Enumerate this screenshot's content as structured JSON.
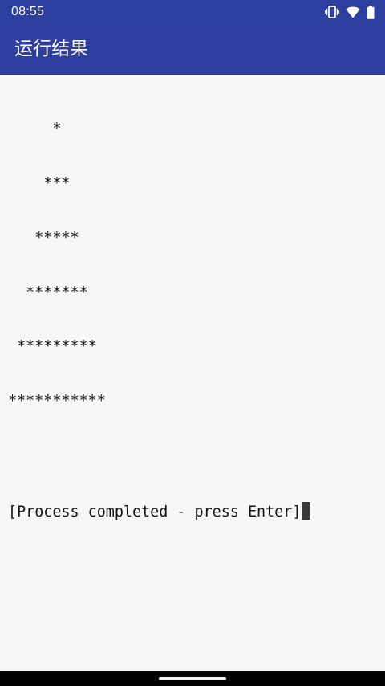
{
  "status_bar": {
    "time": "08:55",
    "icons": [
      "vibrate-icon",
      "wifi-icon",
      "battery-icon"
    ]
  },
  "app_bar": {
    "title": "运行结果"
  },
  "terminal": {
    "lines": [
      "     *",
      "    ***",
      "   *****",
      "  *******",
      " *********",
      "***********",
      "",
      "[Process completed - press Enter]"
    ]
  },
  "colors": {
    "status_bar": "#2c3e9e",
    "app_bar": "#2f3f9f",
    "background": "#f7f7f7",
    "text": "#111111",
    "cursor": "#3a3a3a"
  }
}
